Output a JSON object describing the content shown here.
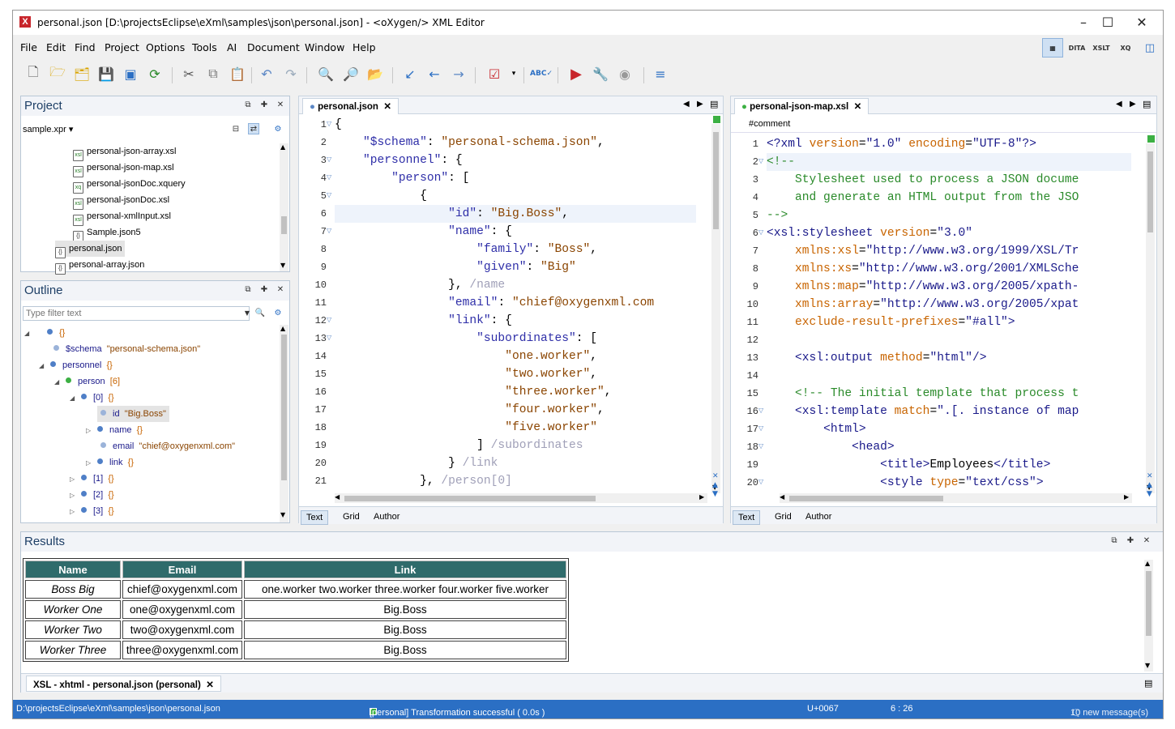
{
  "window": {
    "title": "personal.json [D:\\projectsEclipse\\eXml\\samples\\json\\personal.json] - <oXygen/> XML Editor",
    "icon": "x-logo-icon",
    "controls": [
      "minimize-icon",
      "maximize-icon",
      "close-icon"
    ]
  },
  "menu": [
    "File",
    "Edit",
    "Find",
    "Project",
    "Options",
    "Tools",
    "AI",
    "Document",
    "Window",
    "Help"
  ],
  "perspectives": [
    "Editor",
    "DITA",
    "XSLT",
    "XQ",
    "DB"
  ],
  "project": {
    "title": "Project",
    "selector": "sample.xpr",
    "files": [
      {
        "name": "personal-json-array.xsl",
        "type": "xsl"
      },
      {
        "name": "personal-json-map.xsl",
        "type": "xsl"
      },
      {
        "name": "personal-jsonDoc.xquery",
        "type": "xquery"
      },
      {
        "name": "personal-jsonDoc.xsl",
        "type": "xsl"
      },
      {
        "name": "personal-xmlInput.xsl",
        "type": "xsl"
      },
      {
        "name": "Sample.json5",
        "type": "json"
      },
      {
        "name": "personal.json",
        "type": "json",
        "selected": true
      },
      {
        "name": "personal-array.json",
        "type": "json"
      }
    ]
  },
  "outline": {
    "title": "Outline",
    "filter_placeholder": "Type filter text",
    "nodes": [
      {
        "key": "{}",
        "value": "",
        "level": 0,
        "expanded": true
      },
      {
        "key": "$schema",
        "value": "\"personal-schema.json\"",
        "level": 1
      },
      {
        "key": "personnel",
        "value": "{}",
        "level": 1,
        "expanded": true
      },
      {
        "key": "person",
        "value": "[6]",
        "level": 2,
        "expanded": true,
        "green": true
      },
      {
        "key": "[0]",
        "value": "{}",
        "level": 3,
        "expanded": true
      },
      {
        "key": "id",
        "value": "\"Big.Boss\"",
        "level": 4,
        "selected": true
      },
      {
        "key": "name",
        "value": "{}",
        "level": 4,
        "collapsed": true
      },
      {
        "key": "email",
        "value": "\"chief@oxygenxml.com\"",
        "level": 4
      },
      {
        "key": "link",
        "value": "{}",
        "level": 4,
        "collapsed": true
      },
      {
        "key": "[1]",
        "value": "{}",
        "level": 3,
        "collapsed": true
      },
      {
        "key": "[2]",
        "value": "{}",
        "level": 3,
        "collapsed": true
      },
      {
        "key": "[3]",
        "value": "{}",
        "level": 3,
        "collapsed": true
      }
    ]
  },
  "editor_left": {
    "tab": "personal.json",
    "lines": [
      "{",
      "    \"$schema\": \"personal-schema.json\",",
      "    \"personnel\": {",
      "        \"person\": [",
      "            {",
      "                \"id\": \"Big.Boss\",",
      "                \"name\": {",
      "                    \"family\": \"Boss\",",
      "                    \"given\": \"Big\"",
      "                }, /name",
      "                \"email\": \"chief@oxygenxml.com",
      "                \"link\": {",
      "                    \"subordinates\": [",
      "                        \"one.worker\",",
      "                        \"two.worker\",",
      "                        \"three.worker\",",
      "                        \"four.worker\",",
      "                        \"five.worker\"",
      "                    ] /subordinates",
      "                } /link",
      "            }, /person[0]"
    ],
    "fold_lines": [
      1,
      3,
      4,
      5,
      7,
      12,
      13
    ],
    "modes": [
      "Text",
      "Grid",
      "Author"
    ]
  },
  "editor_right": {
    "tab": "personal-json-map.xsl",
    "breadcrumb": "#comment",
    "lines": [
      "<?xml version=\"1.0\" encoding=\"UTF-8\"?>",
      "<!--",
      "    Stylesheet used to process a JSON docume",
      "    and generate an HTML output from the JSO",
      "-->",
      "<xsl:stylesheet version=\"3.0\"",
      "    xmlns:xsl=\"http://www.w3.org/1999/XSL/Tr",
      "    xmlns:xs=\"http://www.w3.org/2001/XMLSche",
      "    xmlns:map=\"http://www.w3.org/2005/xpath-",
      "    xmlns:array=\"http://www.w3.org/2005/xpat",
      "    exclude-result-prefixes=\"#all\">",
      "",
      "    <xsl:output method=\"html\"/>",
      "",
      "    <!-- The initial template that process t",
      "    <xsl:template match=\".[. instance of map",
      "        <html>",
      "            <head>",
      "                <title>Employees</title>",
      "                <style type=\"text/css\">"
    ],
    "fold_lines": [
      2,
      6,
      16,
      17,
      18,
      20
    ],
    "modes": [
      "Text",
      "Grid",
      "Author"
    ]
  },
  "results": {
    "title": "Results",
    "headers": [
      "Name",
      "Email",
      "Link"
    ],
    "rows": [
      [
        "Boss Big",
        "chief@oxygenxml.com",
        "one.worker two.worker three.worker four.worker five.worker"
      ],
      [
        "Worker One",
        "one@oxygenxml.com",
        "Big.Boss"
      ],
      [
        "Worker Two",
        "two@oxygenxml.com",
        "Big.Boss"
      ],
      [
        "Worker Three",
        "three@oxygenxml.com",
        "Big.Boss"
      ]
    ],
    "tab": "XSL - xhtml - personal.json (personal)"
  },
  "status": {
    "path": "D:\\projectsEclipse\\eXml\\samples\\json\\personal.json",
    "message": "[personal] Transformation successful  ( 0.0s )",
    "char": "U+0067",
    "position": "6 : 26",
    "notifications": "10 new message(s)"
  },
  "colors": {
    "accent": "#2b6fc4",
    "table_header": "#2f6b6b",
    "success": "#3cb043"
  }
}
